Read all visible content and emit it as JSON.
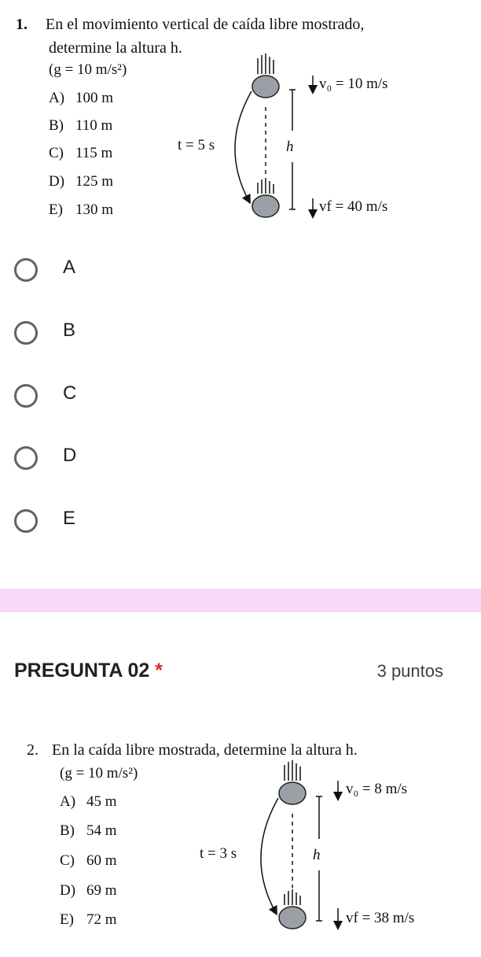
{
  "question1": {
    "number": "1.",
    "text_line1": "En el movimiento vertical de caída libre mostrado,",
    "text_line2": "determine la altura h.",
    "g_note": "(g = 10 m/s²)",
    "options": [
      {
        "letter": "A)",
        "value": "100 m"
      },
      {
        "letter": "B)",
        "value": "110 m"
      },
      {
        "letter": "C)",
        "value": "115 m"
      },
      {
        "letter": "D)",
        "value": "125 m"
      },
      {
        "letter": "E)",
        "value": "130 m"
      }
    ],
    "figure": {
      "v0": "v₀ = 10 m/s",
      "vf": "vf = 40 m/s",
      "t": "t = 5 s",
      "h": "h"
    }
  },
  "answer_choices": [
    "A",
    "B",
    "C",
    "D",
    "E"
  ],
  "question2_header": {
    "title": "PREGUNTA 02",
    "required_mark": "*",
    "points": "3 puntos"
  },
  "question2": {
    "number": "2.",
    "text_line1": "En la caída libre mostrada, determine la altura h.",
    "g_note": "(g = 10 m/s²)",
    "options": [
      {
        "letter": "A)",
        "value": "45 m"
      },
      {
        "letter": "B)",
        "value": "54 m"
      },
      {
        "letter": "C)",
        "value": "60 m"
      },
      {
        "letter": "D)",
        "value": "69 m"
      },
      {
        "letter": "E)",
        "value": "72 m"
      }
    ],
    "figure": {
      "v0": "v₀ = 8 m/s",
      "vf": "vf = 38 m/s",
      "t": "t = 3 s",
      "h": "h"
    }
  },
  "colors": {
    "band": "#fbd9fb",
    "radio_border": "#5f6368",
    "required": "#d93025",
    "ball": "#9aa0a6"
  }
}
